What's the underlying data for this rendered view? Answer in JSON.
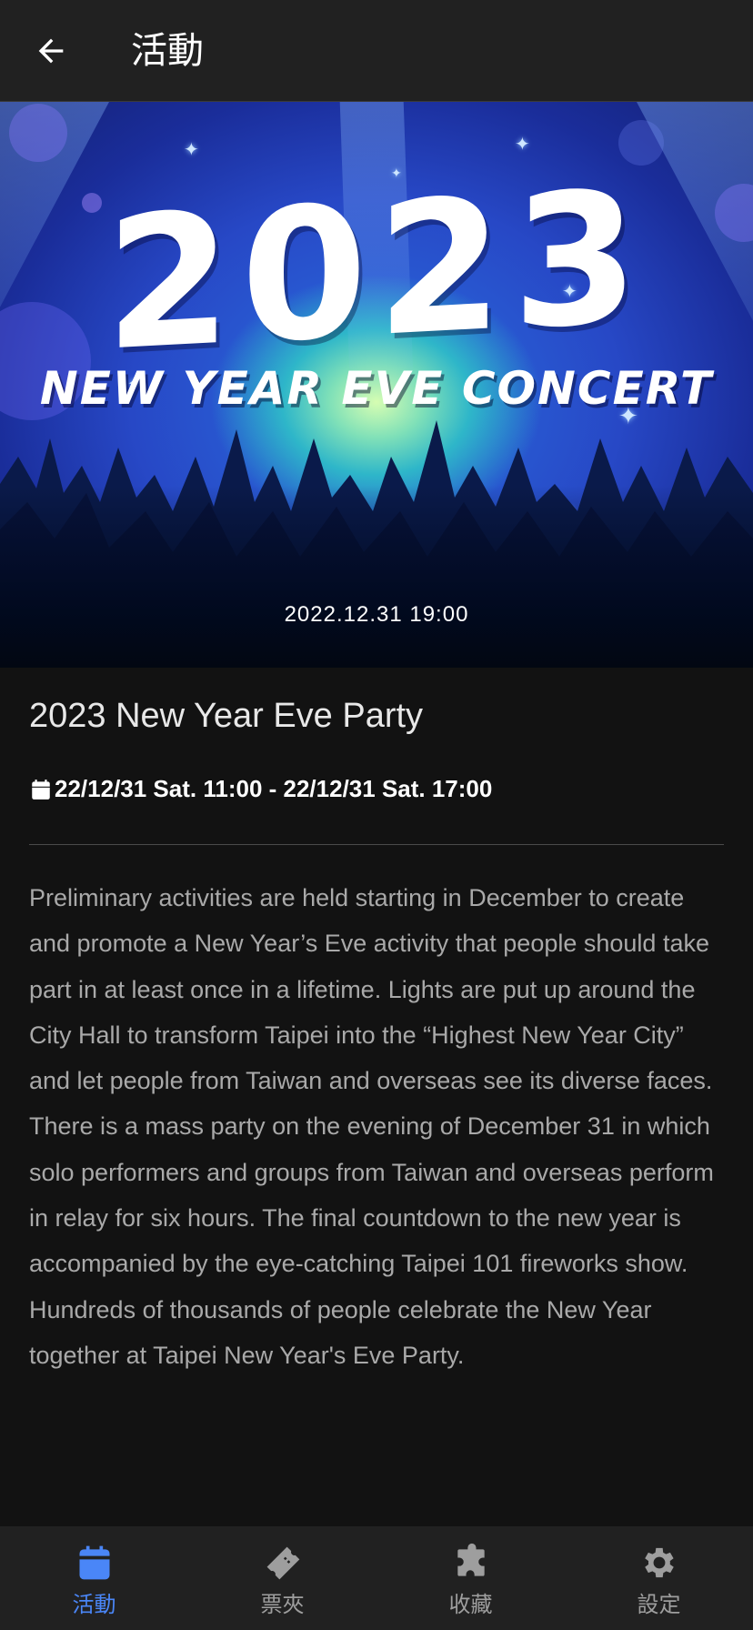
{
  "appbar": {
    "title": "活動",
    "back_icon": "arrow-back-icon"
  },
  "banner": {
    "year": "2023",
    "subtitle": "NEW YEAR EVE CONCERT",
    "datetime": "2022.12.31 19:00"
  },
  "event": {
    "title": "2023 New Year Eve Party",
    "time_icon": "calendar-icon",
    "time": "22/12/31 Sat. 11:00 - 22/12/31 Sat. 17:00",
    "description": "Preliminary activities are held starting in December to create and promote a New Year’s Eve activity that people should take part in at least once in a lifetime. Lights are put up around the City Hall to transform Taipei into the “Highest New Year City” and let people from Taiwan and overseas see its diverse faces. There is a mass party on the evening of December 31 in which solo performers and groups from Taiwan and overseas perform in relay for six hours. The final countdown to the new year is accompanied by the eye-catching Taipei 101 fireworks show. Hundreds of thousands of people celebrate the New Year together at Taipei New Year's Eve Party."
  },
  "bottom_nav": {
    "items": [
      {
        "label": "活動",
        "icon": "calendar-icon",
        "active": true
      },
      {
        "label": "票夾",
        "icon": "ticket-icon",
        "active": false
      },
      {
        "label": "收藏",
        "icon": "puzzle-icon",
        "active": false
      },
      {
        "label": "設定",
        "icon": "gear-icon",
        "active": false
      }
    ]
  },
  "colors": {
    "accent": "#4a86f7",
    "background": "#121212",
    "bar": "#212121"
  }
}
